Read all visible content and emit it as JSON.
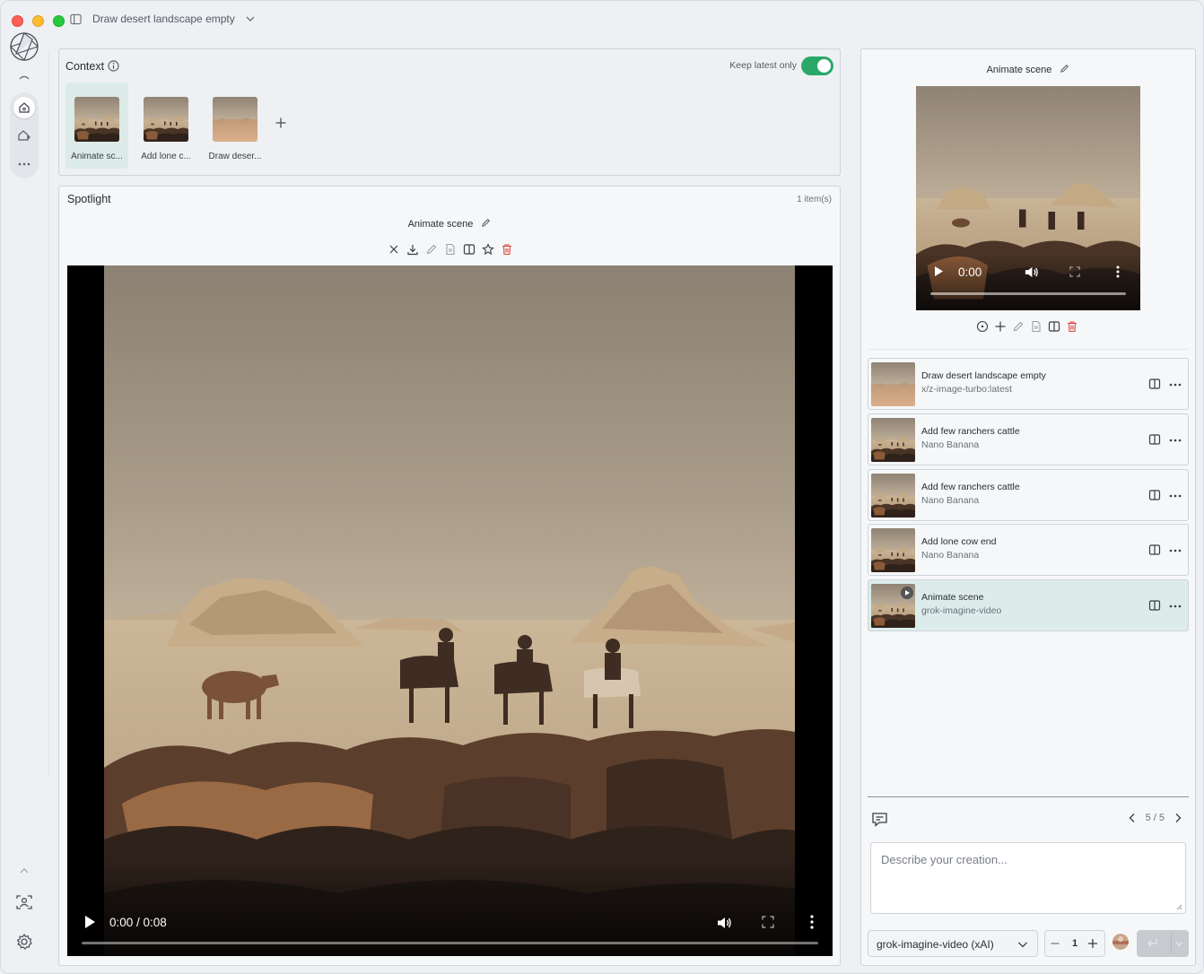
{
  "window": {
    "title": "Draw desert landscape empty"
  },
  "context": {
    "title": "Context",
    "keep_latest_label": "Keep latest only",
    "keep_latest_on": true,
    "items": [
      {
        "label": "Animate sc...",
        "selected": true
      },
      {
        "label": "Add lone c...",
        "selected": false
      },
      {
        "label": "Draw deser...",
        "selected": false
      }
    ]
  },
  "spotlight": {
    "title": "Spotlight",
    "count": "1 item(s)",
    "item_name": "Animate scene",
    "video": {
      "time": "0:00 / 0:08"
    }
  },
  "preview": {
    "name": "Animate scene",
    "time": "0:00"
  },
  "history": [
    {
      "title": "Draw desert landscape empty",
      "model": "x/z-image-turbo:latest",
      "active": false
    },
    {
      "title": "Add few ranchers cattle",
      "model": "Nano Banana",
      "active": false
    },
    {
      "title": "Add few ranchers cattle",
      "model": "Nano Banana",
      "active": false
    },
    {
      "title": "Add lone cow end",
      "model": "Nano Banana",
      "active": false
    },
    {
      "title": "Animate scene",
      "model": "grok-imagine-video",
      "active": true
    }
  ],
  "pager": {
    "text": "5 / 5"
  },
  "composer": {
    "placeholder": "Describe your creation...",
    "model": "grok-imagine-video (xAI)",
    "count": "1"
  },
  "colors": {
    "toggle_on": "#2aa86a",
    "selected_bg": "#dcebe8",
    "delete_red": "#e0443e"
  }
}
